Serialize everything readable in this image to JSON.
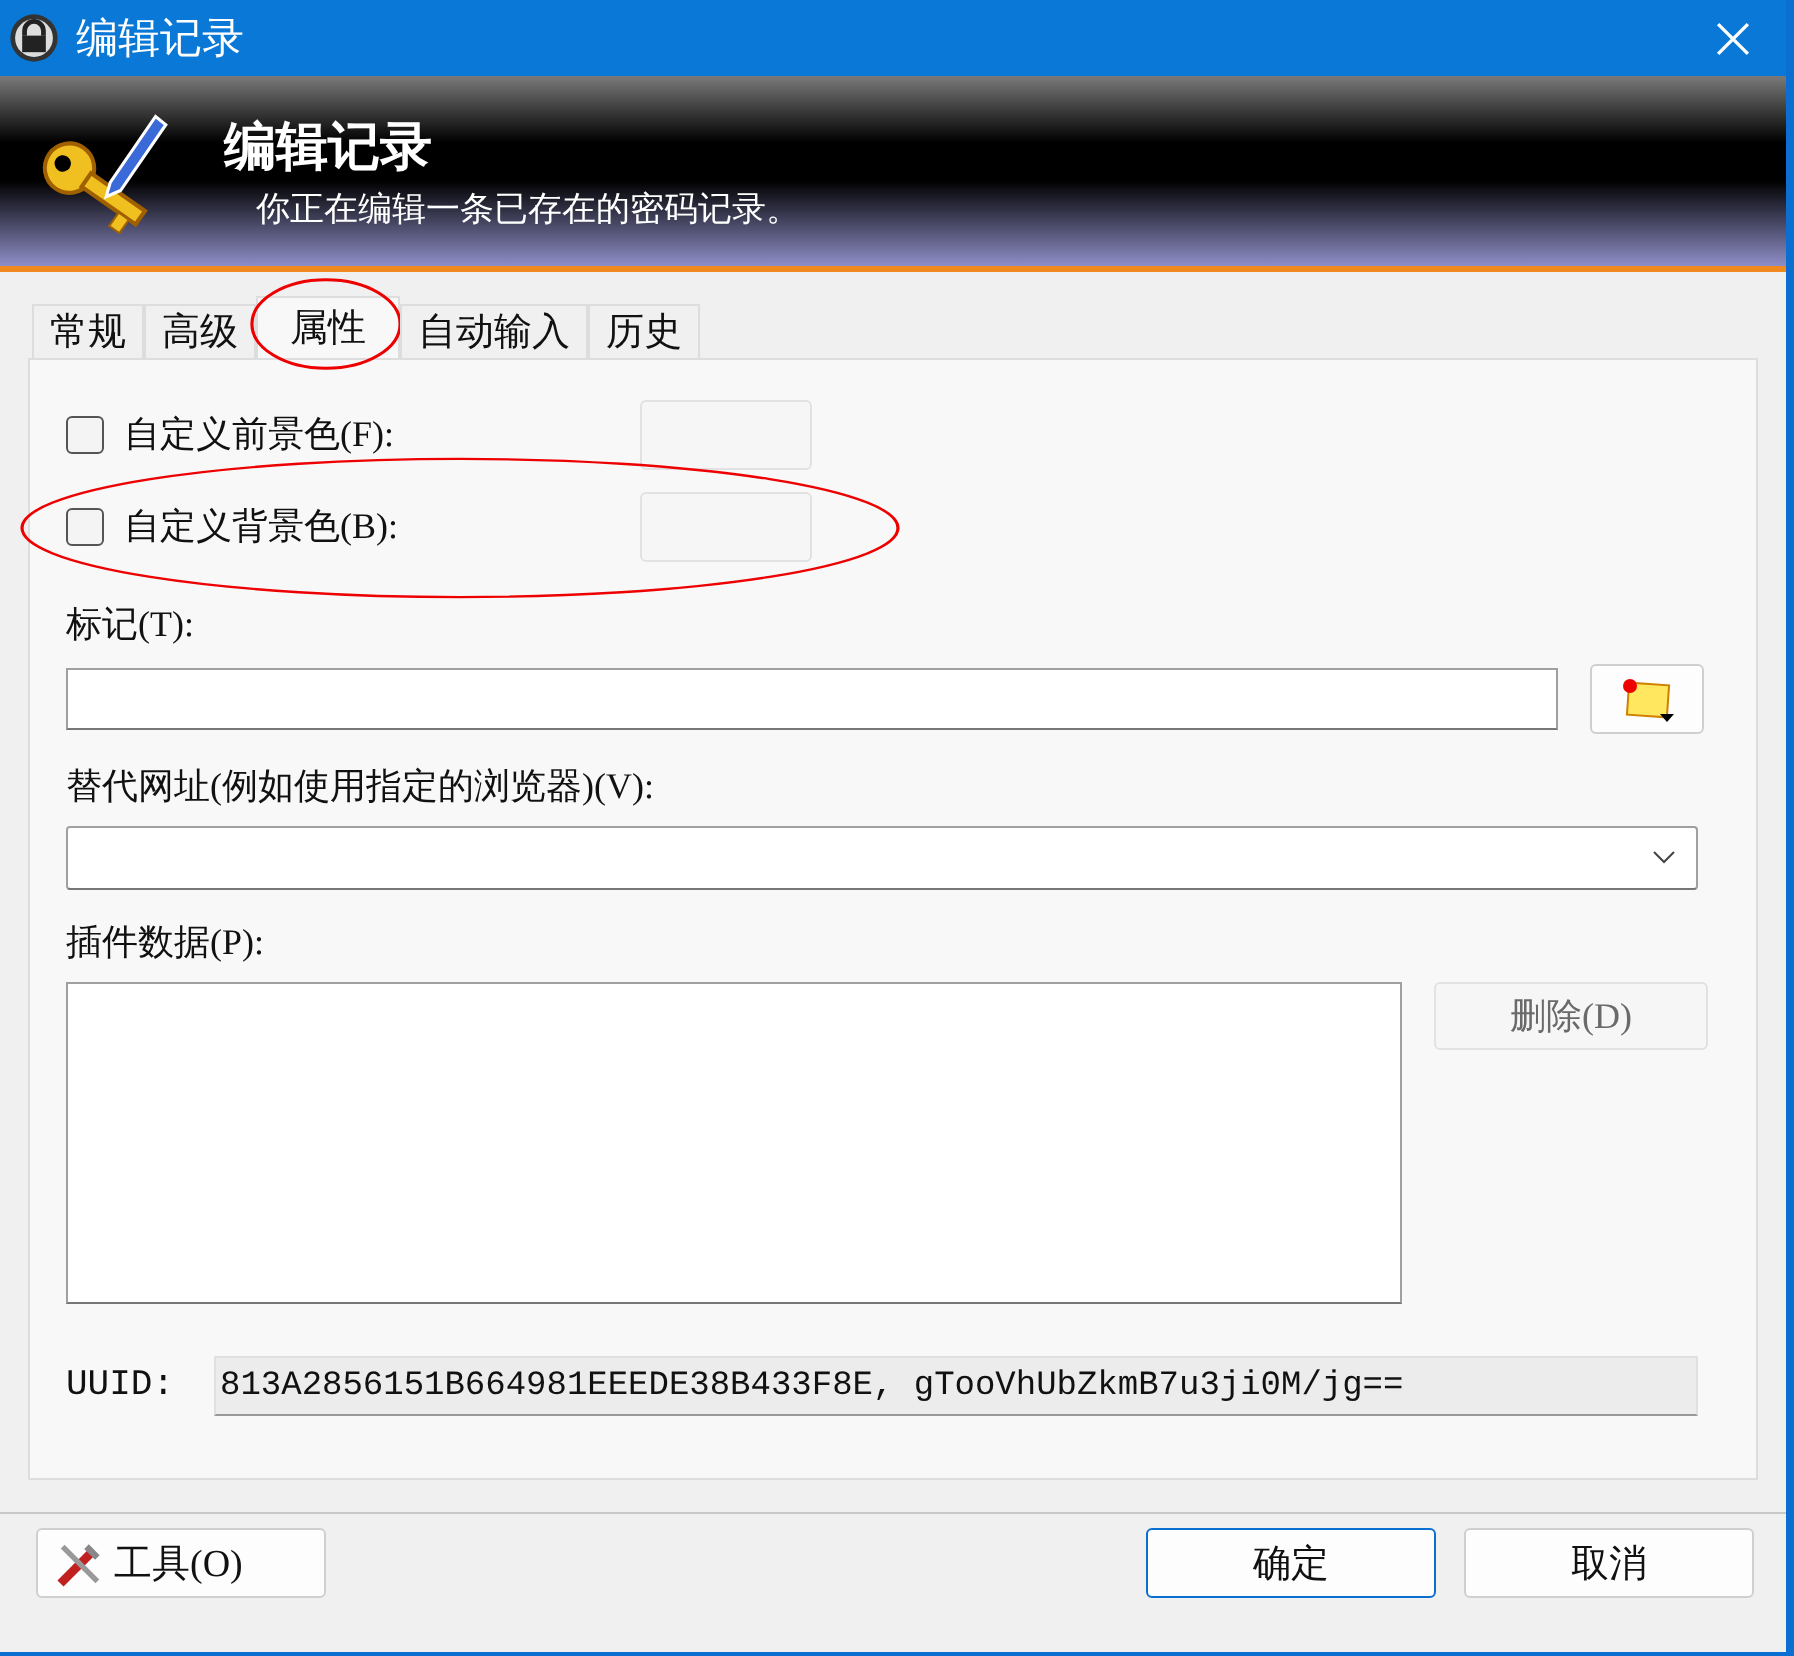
{
  "window": {
    "title": "编辑记录"
  },
  "header": {
    "title": "编辑记录",
    "subtitle": "你正在编辑一条已存在的密码记录。"
  },
  "tabs": [
    {
      "label": "常规",
      "selected": false
    },
    {
      "label": "高级",
      "selected": false
    },
    {
      "label": "属性",
      "selected": true
    },
    {
      "label": "自动输入",
      "selected": false
    },
    {
      "label": "历史",
      "selected": false
    }
  ],
  "color_options": [
    {
      "label": "自定义前景色(F):",
      "checked": false
    },
    {
      "label": "自定义背景色(B):",
      "checked": false
    }
  ],
  "tags": {
    "label": "标记(T):"
  },
  "override_url": {
    "label": "替代网址(例如使用指定的浏览器)(V):"
  },
  "plugin_data": {
    "label": "插件数据(P):",
    "delete_button": "删除(D)",
    "delete_disabled": true
  },
  "uuid": {
    "label": "UUID:",
    "value": "813A2856151B664981EEEDE38B433F8E, gTooVhUbZkmB7u3ji0M/jg=="
  },
  "buttons": {
    "tools": "工具(O)",
    "ok": "确定",
    "cancel": "取消"
  },
  "annotations": [
    {
      "kind": "ellipse"
    },
    {
      "kind": "ellipse"
    }
  ]
}
